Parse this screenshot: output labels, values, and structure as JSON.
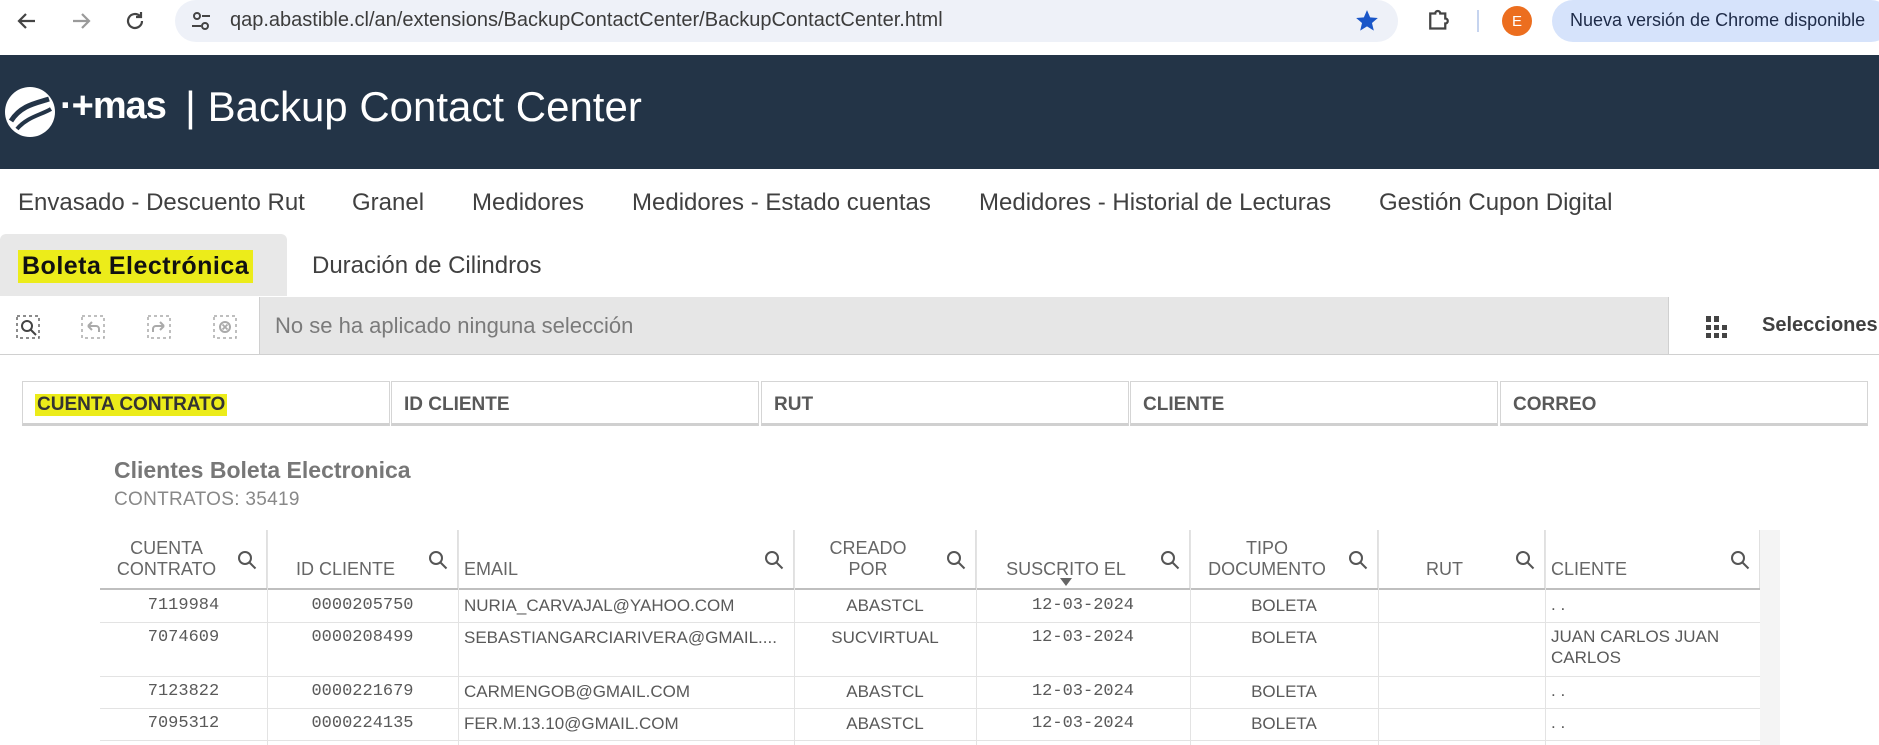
{
  "browser": {
    "url": "qap.abastible.cl/an/extensions/BackupContactCenter/BackupContactCenter.html",
    "profile_initial": "E",
    "update_notice": "Nueva versión de Chrome disponible"
  },
  "header": {
    "logo_text": "·+mas",
    "title": "| Backup Contact Center"
  },
  "tabs": [
    "Envasado - Descuento Rut",
    "Granel",
    "Medidores",
    "Medidores - Estado cuentas",
    "Medidores - Historial de Lecturas",
    "Gestión Cupon Digital",
    "Boleta Electrónica",
    "Duración de Cilindros"
  ],
  "selection_bar": {
    "message": "No se ha aplicado ninguna selección",
    "selections_label": "Selecciones"
  },
  "filters": [
    "CUENTA CONTRATO",
    "ID CLIENTE",
    "RUT",
    "CLIENTE",
    "CORREO"
  ],
  "table_section": {
    "title": "Clientes Boleta Electronica",
    "subtitle": "CONTRATOS: 35419"
  },
  "table": {
    "columns": [
      [
        "CUENTA",
        "CONTRATO"
      ],
      [
        "ID CLIENTE"
      ],
      [
        "EMAIL"
      ],
      [
        "CREADO",
        "POR"
      ],
      [
        "SUSCRITO EL"
      ],
      [
        "TIPO",
        "DOCUMENTO"
      ],
      [
        "RUT"
      ],
      [
        "CLIENTE"
      ]
    ],
    "rows": [
      [
        "7119984",
        "0000205750",
        "NURIA_CARVAJAL@YAHOO.COM",
        "ABASTCL",
        "12-03-2024",
        "BOLETA",
        "",
        ". ."
      ],
      [
        "7074609",
        "0000208499",
        "SEBASTIANGARCIARIVERA@GMAIL....",
        "SUCVIRTUAL",
        "12-03-2024",
        "BOLETA",
        "",
        "JUAN CARLOS JUAN CARLOS"
      ],
      [
        "7123822",
        "0000221679",
        "CARMENGOB@GMAIL.COM",
        "ABASTCL",
        "12-03-2024",
        "BOLETA",
        "",
        ". ."
      ],
      [
        "7095312",
        "0000224135",
        "FER.M.13.10@GMAIL.COM",
        "ABASTCL",
        "12-03-2024",
        "BOLETA",
        "",
        ". ."
      ]
    ]
  },
  "colors": {
    "header_bg": "#233447",
    "highlight": "#ecec1a",
    "chrome_accent": "#1a73e8"
  }
}
